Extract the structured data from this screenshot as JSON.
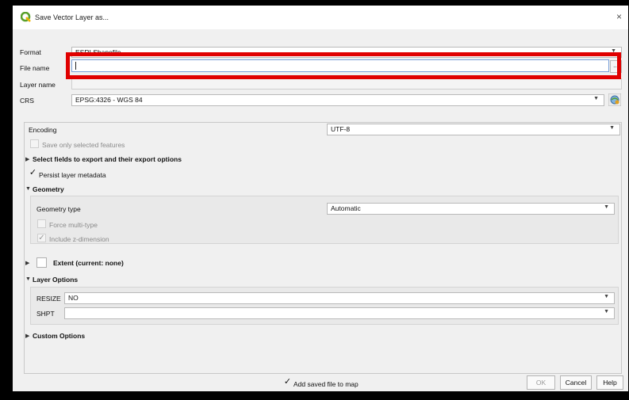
{
  "window": {
    "title": "Save Vector Layer as...",
    "close": "×"
  },
  "form": {
    "format_label": "Format",
    "format_value": "ESRI Shapefile",
    "filename_label": "File name",
    "filename_value": "",
    "browse_label": "...",
    "layername_label": "Layer name",
    "crs_label": "CRS",
    "crs_value": "EPSG:4326 - WGS 84"
  },
  "options": {
    "encoding_label": "Encoding",
    "encoding_value": "UTF-8",
    "save_selected": "Save only selected features",
    "select_fields": "Select fields to export and their export options",
    "persist_metadata": "Persist layer metadata",
    "geometry_header": "Geometry",
    "geometry_type_label": "Geometry type",
    "geometry_type_value": "Automatic",
    "force_multi": "Force multi-type",
    "include_z": "Include z-dimension",
    "extent": "Extent (current: none)",
    "layer_options_header": "Layer Options",
    "resize_label": "RESIZE",
    "resize_value": "NO",
    "shpt_label": "SHPT",
    "shpt_value": "",
    "custom_options": "Custom Options"
  },
  "footer": {
    "add_saved": "Add saved file to map",
    "ok": "OK",
    "cancel": "Cancel",
    "help": "Help"
  },
  "colors": {
    "highlight": "#e00000",
    "qgis_green": "#5aa02c"
  }
}
